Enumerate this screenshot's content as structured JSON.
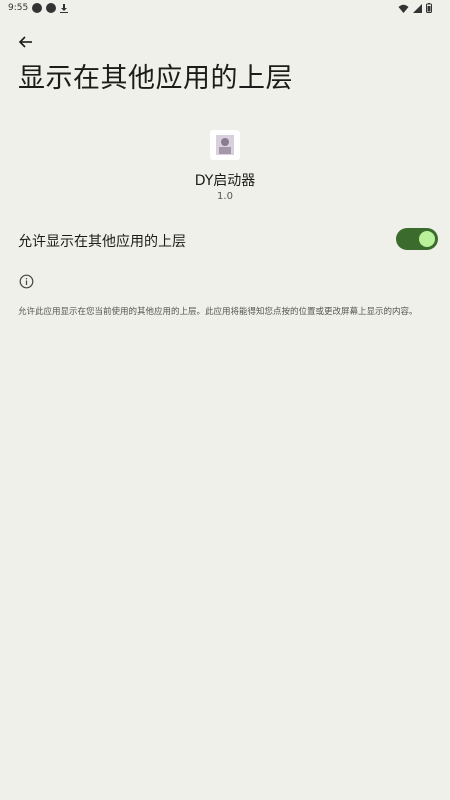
{
  "status_bar": {
    "time": "9:55",
    "left_icons": [
      "notification-icon",
      "notification-icon",
      "download-icon"
    ],
    "right_icons": [
      "wifi-icon",
      "signal-icon",
      "battery-icon"
    ]
  },
  "header": {
    "back_icon": "arrow-back-icon",
    "title": "显示在其他应用的上层"
  },
  "app": {
    "name": "DY启动器",
    "version": "1.0"
  },
  "permission": {
    "label": "允许显示在其他应用的上层",
    "enabled": true,
    "accent_color": "#3c6b2e",
    "knob_color": "#b9f29a"
  },
  "info": {
    "icon": "info-icon",
    "description": "允许此应用显示在您当前使用的其他应用的上层。此应用将能得知您点按的位置或更改屏幕上显示的内容。"
  }
}
